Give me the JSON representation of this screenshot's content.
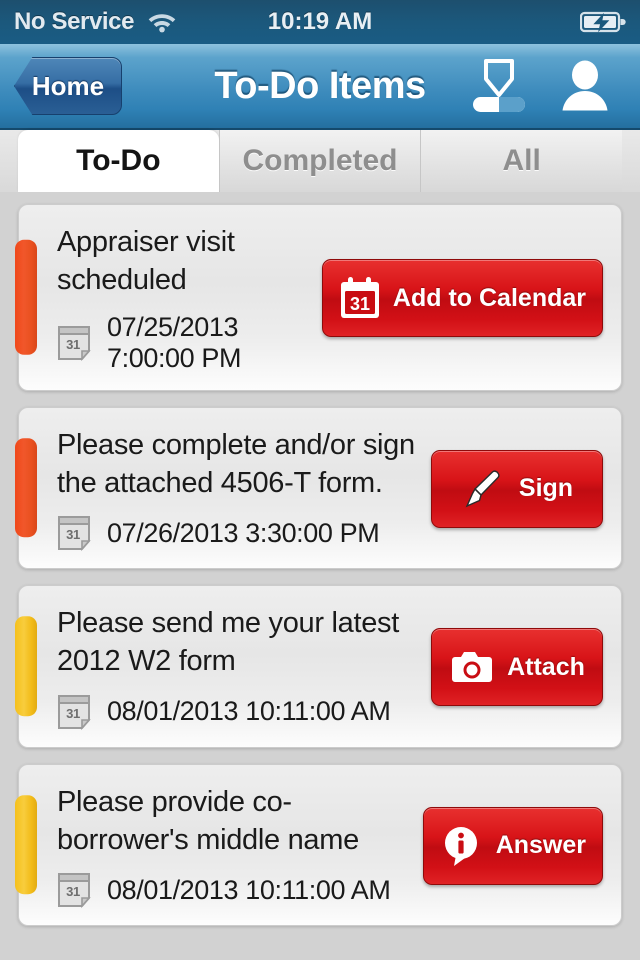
{
  "status_bar": {
    "carrier": "No Service",
    "wifi_icon": "wifi-icon",
    "time": "10:19 AM",
    "battery_icon": "battery-charging-icon"
  },
  "nav_bar": {
    "back_label": "Home",
    "title": "To-Do Items",
    "icons": [
      {
        "name": "download-progress-icon"
      },
      {
        "name": "profile-icon"
      }
    ]
  },
  "tabs": [
    {
      "label": "To-Do",
      "active": true
    },
    {
      "label": "Completed",
      "active": false
    },
    {
      "label": "All",
      "active": false
    }
  ],
  "colors": {
    "accent_orange": "#f0481a",
    "accent_yellow": "#f5c01c",
    "action_red": "#d81418",
    "nav_blue": "#3e8cbd",
    "status_blue": "#1b587c"
  },
  "items": [
    {
      "title": "Appraiser visit scheduled",
      "date": "07/25/2013 7:00:00 PM",
      "date_icon": "calendar-icon",
      "priority": "orange",
      "action": {
        "label": "Add to Calendar",
        "icon": "calendar-31-icon"
      }
    },
    {
      "title": "Please complete and/or sign the attached 4506-T form.",
      "date": "07/26/2013 3:30:00 PM",
      "date_icon": "calendar-icon",
      "priority": "orange",
      "action": {
        "label": "Sign",
        "icon": "pen-icon"
      }
    },
    {
      "title": "Please send me your latest 2012 W2 form",
      "date": "08/01/2013 10:11:00 AM",
      "date_icon": "calendar-icon",
      "priority": "yellow",
      "action": {
        "label": "Attach",
        "icon": "camera-icon"
      }
    },
    {
      "title": "Please provide co-borrower's middle name",
      "date": "08/01/2013 10:11:00 AM",
      "date_icon": "calendar-icon",
      "priority": "yellow",
      "action": {
        "label": "Answer",
        "icon": "info-bubble-icon"
      }
    }
  ]
}
